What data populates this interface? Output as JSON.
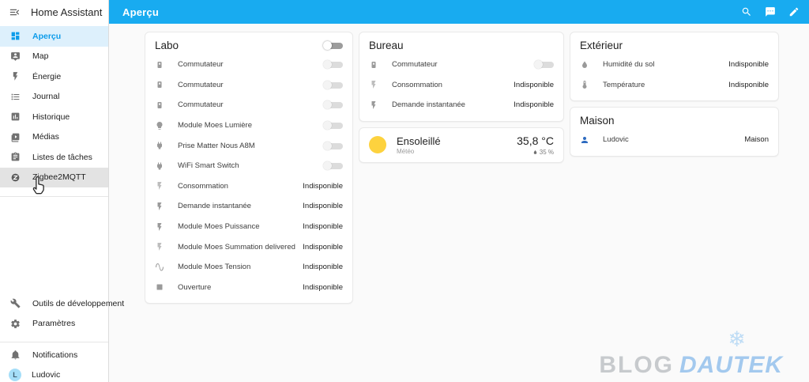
{
  "app": {
    "title": "Home Assistant"
  },
  "header": {
    "title": "Aperçu",
    "icons": [
      "search-icon",
      "chat-icon",
      "pencil-icon"
    ]
  },
  "sidebar": {
    "items": [
      {
        "label": "Aperçu",
        "icon": "dashboard-icon",
        "active": true
      },
      {
        "label": "Map",
        "icon": "map-icon"
      },
      {
        "label": "Énergie",
        "icon": "energy-icon"
      },
      {
        "label": "Journal",
        "icon": "journal-icon"
      },
      {
        "label": "Historique",
        "icon": "history-icon"
      },
      {
        "label": "Médias",
        "icon": "media-icon"
      },
      {
        "label": "Listes de tâches",
        "icon": "todo-icon"
      },
      {
        "label": "Zigbee2MQTT",
        "icon": "zigbee-icon",
        "hovered": true
      }
    ],
    "tool_items": [
      {
        "label": "Outils de développement",
        "icon": "devtools-icon"
      },
      {
        "label": "Paramètres",
        "icon": "settings-icon"
      }
    ],
    "footer": {
      "notifications_label": "Notifications",
      "user_name": "Ludovic",
      "user_initial": "L"
    }
  },
  "cards": {
    "labo": {
      "title": "Labo",
      "rows": [
        {
          "icon": "power-socket-icon",
          "label": "Commutateur",
          "control": "toggle"
        },
        {
          "icon": "power-socket-icon",
          "label": "Commutateur",
          "control": "toggle"
        },
        {
          "icon": "power-socket-icon",
          "label": "Commutateur",
          "control": "toggle"
        },
        {
          "icon": "lightbulb-icon",
          "label": "Module Moes Lumière",
          "control": "toggle"
        },
        {
          "icon": "power-plug-icon",
          "label": "Prise Matter Nous A8M",
          "control": "toggle"
        },
        {
          "icon": "power-plug-icon",
          "label": "WiFi Smart Switch",
          "control": "toggle"
        },
        {
          "icon": "flash-outline-icon",
          "label": "Consommation",
          "status": "Indisponible"
        },
        {
          "icon": "flash-icon",
          "label": "Demande instantanée",
          "status": "Indisponible"
        },
        {
          "icon": "flash-icon",
          "label": "Module Moes Puissance",
          "status": "Indisponible"
        },
        {
          "icon": "flash-outline-icon",
          "label": "Module Moes Summation delivered",
          "status": "Indisponible"
        },
        {
          "icon": "sine-wave-icon",
          "label": "Module Moes Tension",
          "status": "Indisponible"
        },
        {
          "icon": "square-icon",
          "label": "Ouverture",
          "status": "Indisponible"
        }
      ]
    },
    "bureau": {
      "title": "Bureau",
      "rows": [
        {
          "icon": "power-socket-icon",
          "label": "Commutateur",
          "control": "toggle"
        },
        {
          "icon": "flash-outline-icon",
          "label": "Consommation",
          "status": "Indisponible"
        },
        {
          "icon": "flash-icon",
          "label": "Demande instantanée",
          "status": "Indisponible"
        }
      ]
    },
    "weather": {
      "condition": "Ensoleillé",
      "entity_name": "Météo",
      "temperature": "35,8 °C",
      "humidity": "35 %"
    },
    "exterieur": {
      "title": "Extérieur",
      "rows": [
        {
          "icon": "water-drop-icon",
          "label": "Humidité du sol",
          "status": "Indisponible"
        },
        {
          "icon": "thermometer-icon",
          "label": "Température",
          "status": "Indisponible"
        }
      ]
    },
    "maison": {
      "title": "Maison",
      "rows": [
        {
          "icon": "person-icon",
          "label": "Ludovic",
          "status": "Maison"
        }
      ]
    }
  },
  "watermark": {
    "brand_primary": "BLOG",
    "brand_secondary": "DAUTEK",
    "snowflake": "❄"
  },
  "colors": {
    "header_blue": "#18abf0",
    "accent": "#0d9cea",
    "active_item_bg": "#ddf0fc",
    "sun_yellow": "#fdd23e",
    "person_blue": "#2e6bc0",
    "watermark_gray": "#c7cacd",
    "watermark_blue": "#a3c9ee"
  }
}
